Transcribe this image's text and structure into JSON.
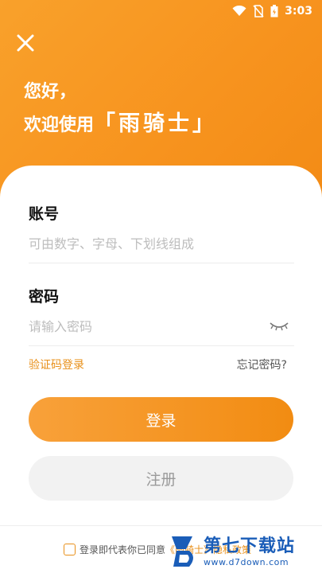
{
  "status_bar": {
    "time": "3:03"
  },
  "header": {
    "greeting_line1": "您好，",
    "greeting_prefix": "欢迎使用",
    "brand_name": "「雨骑士」",
    "accent_color": "#f7931e"
  },
  "form": {
    "account_label": "账号",
    "account_placeholder": "可由数字、字母、下划线组成",
    "password_label": "密码",
    "password_placeholder": "请输入密码"
  },
  "links": {
    "sms_login": "验证码登录",
    "forgot_password": "忘记密码?"
  },
  "buttons": {
    "login": "登录",
    "register": "注册"
  },
  "agreement": {
    "prefix": "登录即代表你已同意",
    "policy": "《雨骑士》隐私政策"
  },
  "watermark": {
    "title": "第七下载站",
    "url": "www.d7down.com"
  },
  "icons": {
    "close": "close-icon",
    "eye": "eye-closed-icon",
    "wifi": "wifi-icon",
    "no-sim": "no-sim-icon",
    "battery": "battery-icon"
  }
}
